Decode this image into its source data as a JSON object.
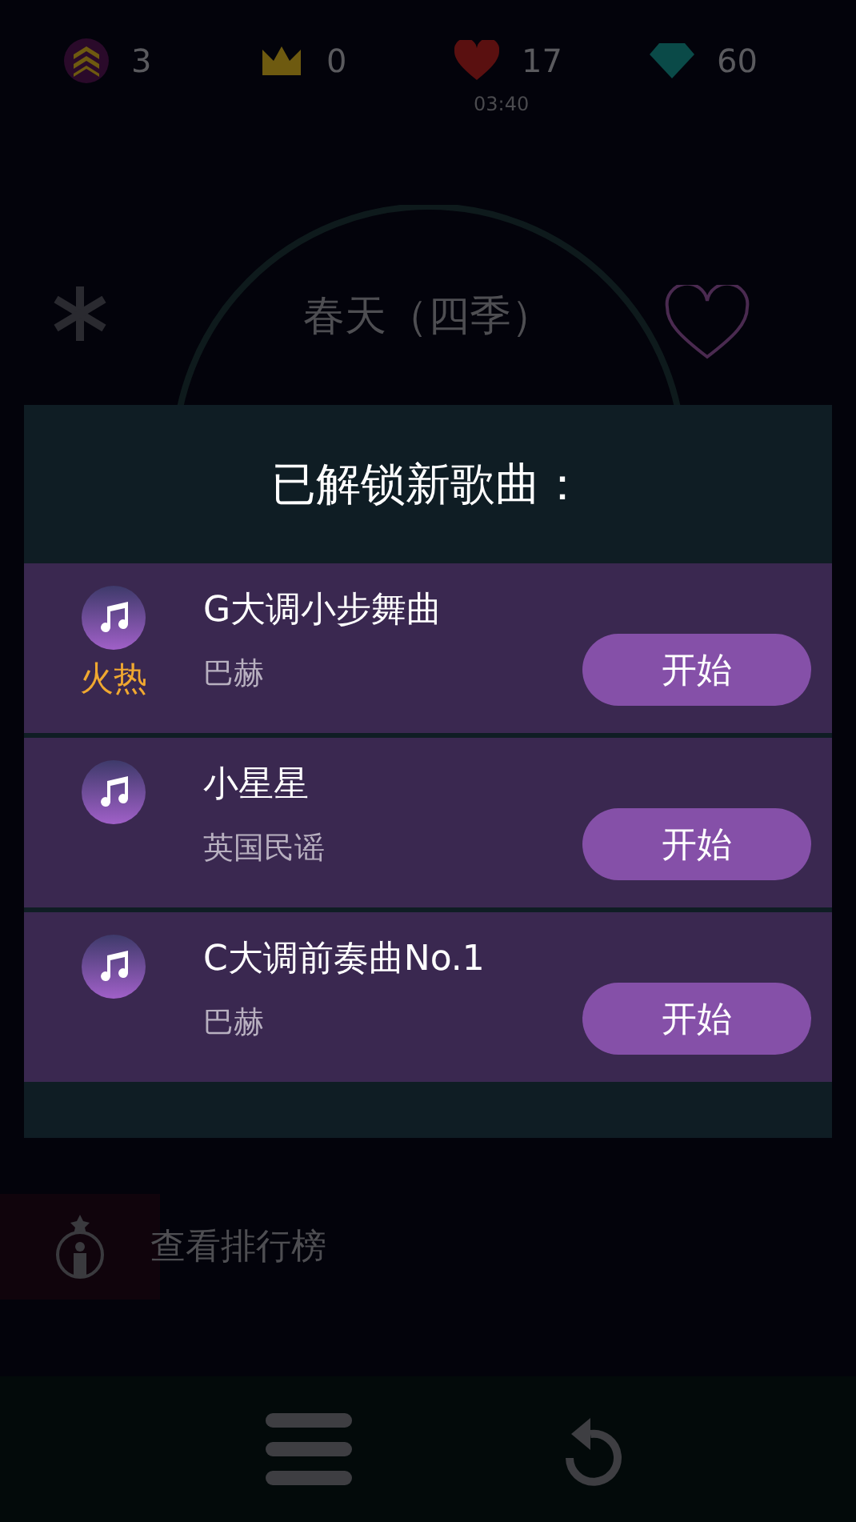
{
  "stats": [
    {
      "kind": "level",
      "value": "3"
    },
    {
      "kind": "crown",
      "value": "0"
    },
    {
      "kind": "heart",
      "value": "17",
      "timer": "03:40"
    },
    {
      "kind": "gem",
      "value": "60"
    }
  ],
  "song_title": "春天（四季）",
  "dialog": {
    "title": "已解锁新歌曲：",
    "songs": [
      {
        "name": "G大调小步舞曲",
        "artist": "巴赫",
        "tag": "火热",
        "button": "开始"
      },
      {
        "name": "小星星",
        "artist": "英国民谣",
        "button": "开始"
      },
      {
        "name": "C大调前奏曲No.1",
        "artist": "巴赫",
        "button": "开始"
      }
    ]
  },
  "leaderboard_link": "查看排行榜"
}
